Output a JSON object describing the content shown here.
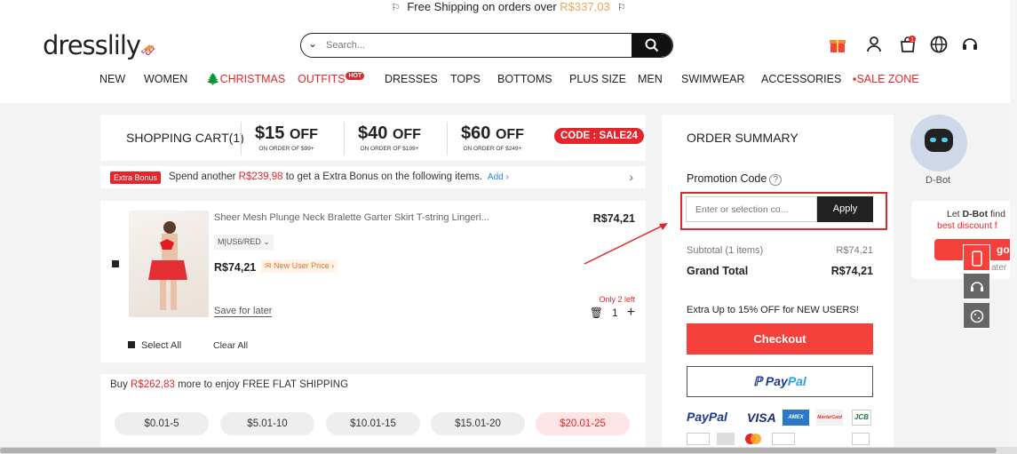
{
  "topbar": {
    "text": "Free Shipping on orders over ",
    "amount": "R$337,03"
  },
  "header": {
    "logo": "dresslily",
    "search_placeholder": "Search...",
    "nav": [
      {
        "label": "NEW"
      },
      {
        "label": "WOMEN"
      },
      {
        "label": "CHRISTMAS"
      },
      {
        "label": "OUTFITS"
      },
      {
        "label": "DRESSES"
      },
      {
        "label": "TOPS"
      },
      {
        "label": "BOTTOMS"
      },
      {
        "label": "PLUS SIZE"
      },
      {
        "label": "MEN"
      },
      {
        "label": "SWIMWEAR"
      },
      {
        "label": "ACCESSORIES"
      },
      {
        "label": "SALE ZONE"
      }
    ],
    "hot_badge": "HOT",
    "cart_count": "1"
  },
  "cart": {
    "title": "SHOPPING CART(1)",
    "promos": [
      {
        "amount": "$15",
        "off": "OFF",
        "sub": "ON ORDER OF $99+"
      },
      {
        "amount": "$40",
        "off": "OFF",
        "sub": "ON ORDER OF $199+"
      },
      {
        "amount": "$60",
        "off": "OFF",
        "sub": "ON ORDER OF $249+"
      }
    ],
    "code": "CODE : SALE24",
    "bonus_tag": "Extra Bonus",
    "bonus_pre": "Spend another ",
    "bonus_amount": "R$239,98",
    "bonus_post": " to get a Extra Bonus on the following items.",
    "bonus_add": "Add",
    "item": {
      "name": "Sheer Mesh Plunge Neck Bralette Garter Skirt T-string Lingeri...",
      "price": "R$74,21",
      "variant": "M|US6/RED",
      "new_user": "New User Price",
      "save_later": "Save for later",
      "stock": "Only 2 left",
      "qty": "1"
    },
    "select_all": "Select All",
    "clear_all": "Clear All",
    "ship_pre": "Buy ",
    "ship_amount": "R$262,83",
    "ship_post": " more to enjoy FREE FLAT SHIPPING",
    "ranges": [
      {
        "label": "$0.01-5"
      },
      {
        "label": "$5.01-10"
      },
      {
        "label": "$10.01-15"
      },
      {
        "label": "$15.01-20"
      },
      {
        "label": "$20.01-25"
      }
    ]
  },
  "summary": {
    "title": "ORDER SUMMARY",
    "promo_label": "Promotion Code",
    "promo_placeholder": "Enter or selection co...",
    "apply": "Apply",
    "subtotal_label": "Subtotal (1 items)",
    "subtotal": "R$74,21",
    "grand_label": "Grand Total",
    "grand": "R$74,21",
    "extra": "Extra Up to 15% OFF for NEW USERS!",
    "checkout": "Checkout",
    "paypal_a": "Pay",
    "paypal_b": "Pal",
    "payments_row1": [
      "PayPal",
      "VISA",
      "AMEX",
      "MasterCard",
      "JCB"
    ]
  },
  "dbot": {
    "label": "D-Bot",
    "l1_pre": "Let ",
    "l1_bold": "D-Bot",
    "l1_post": " find",
    "l2": "best discount f",
    "go": "go",
    "l3": "ater"
  }
}
